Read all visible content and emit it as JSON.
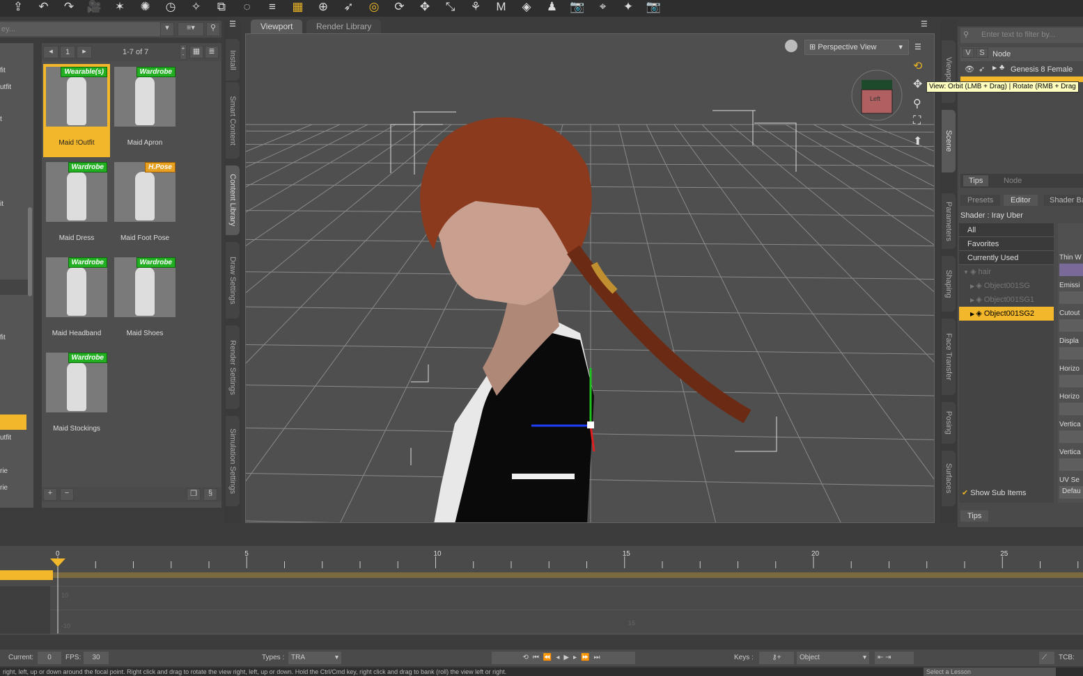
{
  "toolbar": {
    "icons": [
      "save-icon",
      "undo-icon",
      "redo-icon",
      "camera-icon",
      "distant-light-icon",
      "point-light-icon",
      "spot-light-icon",
      "flashlight-icon",
      "transform-icon",
      "node-weight-icon",
      "align-icon",
      "grid-icon",
      "universal-tool-icon",
      "select-icon",
      "orbit-icon",
      "rotate-icon",
      "translate-icon",
      "scale-icon",
      "joint-editor-icon",
      "geometry-editor-icon",
      "surface-selection-icon",
      "figure-setup-icon",
      "render-icon",
      "spot-render-icon",
      "node-selection-icon",
      "render-settings-icon"
    ]
  },
  "content": {
    "search_placeholder": "ey...",
    "page": "1",
    "count_label": "1-7 of 7",
    "categories": [
      "fit",
      "utfit",
      "t",
      "it",
      "fit",
      "utfit",
      "rie",
      "rie"
    ],
    "items": [
      {
        "label": "Maid !Outfit",
        "badge": "Wearable(s)",
        "selected": true
      },
      {
        "label": "Maid Apron",
        "badge": "Wardrobe"
      },
      {
        "label": "Maid Dress",
        "badge": "Wardrobe"
      },
      {
        "label": "Maid Foot Pose",
        "badge": "H.Pose"
      },
      {
        "label": "Maid Headband",
        "badge": "Wardrobe"
      },
      {
        "label": "Maid Shoes",
        "badge": "Wardrobe"
      },
      {
        "label": "Maid Stockings",
        "badge": "Wardrobe"
      }
    ]
  },
  "left_tabs": [
    "Install",
    "Smart Content",
    "Content Library",
    "Draw Settings",
    "Render Settings",
    "Simulation Settings"
  ],
  "viewport": {
    "tabs": [
      "Viewport",
      "Render Library"
    ],
    "view": "Perspective View",
    "cube_label": "Left",
    "tooltip": "View: Orbit (LMB + Drag) | Rotate (RMB + Drag"
  },
  "right_tabs": [
    "Viewport",
    "Scene",
    "Parameters",
    "Shaping",
    "Face Transfer",
    "Posing",
    "Surfaces"
  ],
  "scene": {
    "filter_placeholder": "Enter text to filter by...",
    "col_v": "V",
    "col_s": "S",
    "col_node": "Node",
    "node": "Genesis 8 Female",
    "tabs": [
      "Tips",
      "Node"
    ]
  },
  "surfaces": {
    "tabs": [
      "Presets",
      "Editor",
      "Shader Ba"
    ],
    "shader": "Shader : Iray Uber",
    "filters": [
      "All",
      "Favorites",
      "Currently Used"
    ],
    "tree": [
      {
        "label": "hair",
        "level": 0
      },
      {
        "label": "Object001SG",
        "level": 1
      },
      {
        "label": "Object001SG1",
        "level": 1
      },
      {
        "label": "Object001SG2",
        "level": 1,
        "selected": true
      }
    ],
    "show_sub_items": "Show Sub Items",
    "show_sub_checked": true,
    "props": [
      "Thin W",
      "Emissi",
      "Cutout",
      "Displa",
      "Horizo",
      "Horizo",
      "Vertica",
      "Vertica",
      "UV Se"
    ],
    "uv_value": "Defau",
    "tips": "Tips"
  },
  "timeline": {
    "ticks": [
      "0",
      "5",
      "10",
      "15",
      "20",
      "25"
    ],
    "graph_labels": [
      "10",
      "-10",
      "15"
    ],
    "current_frame": 0
  },
  "bottom": {
    "current_label": "Current:",
    "current": "0",
    "fps_label": "FPS:",
    "fps": "30",
    "types_label": "Types :",
    "types": "TRA",
    "keys_label": "Keys :",
    "keys_mode": "Object",
    "tcb_label": "TCB:"
  },
  "status": {
    "text": "right, left, up or down around the focal point. Right click and drag to rotate the view right, left, up or down. Hold the Ctrl/Cmd key, right click and drag to bank (roll) the view left or right.",
    "lesson": "Select a Lesson"
  },
  "colors": {
    "accent": "#f2b72a",
    "badge_green": "#22b022"
  }
}
